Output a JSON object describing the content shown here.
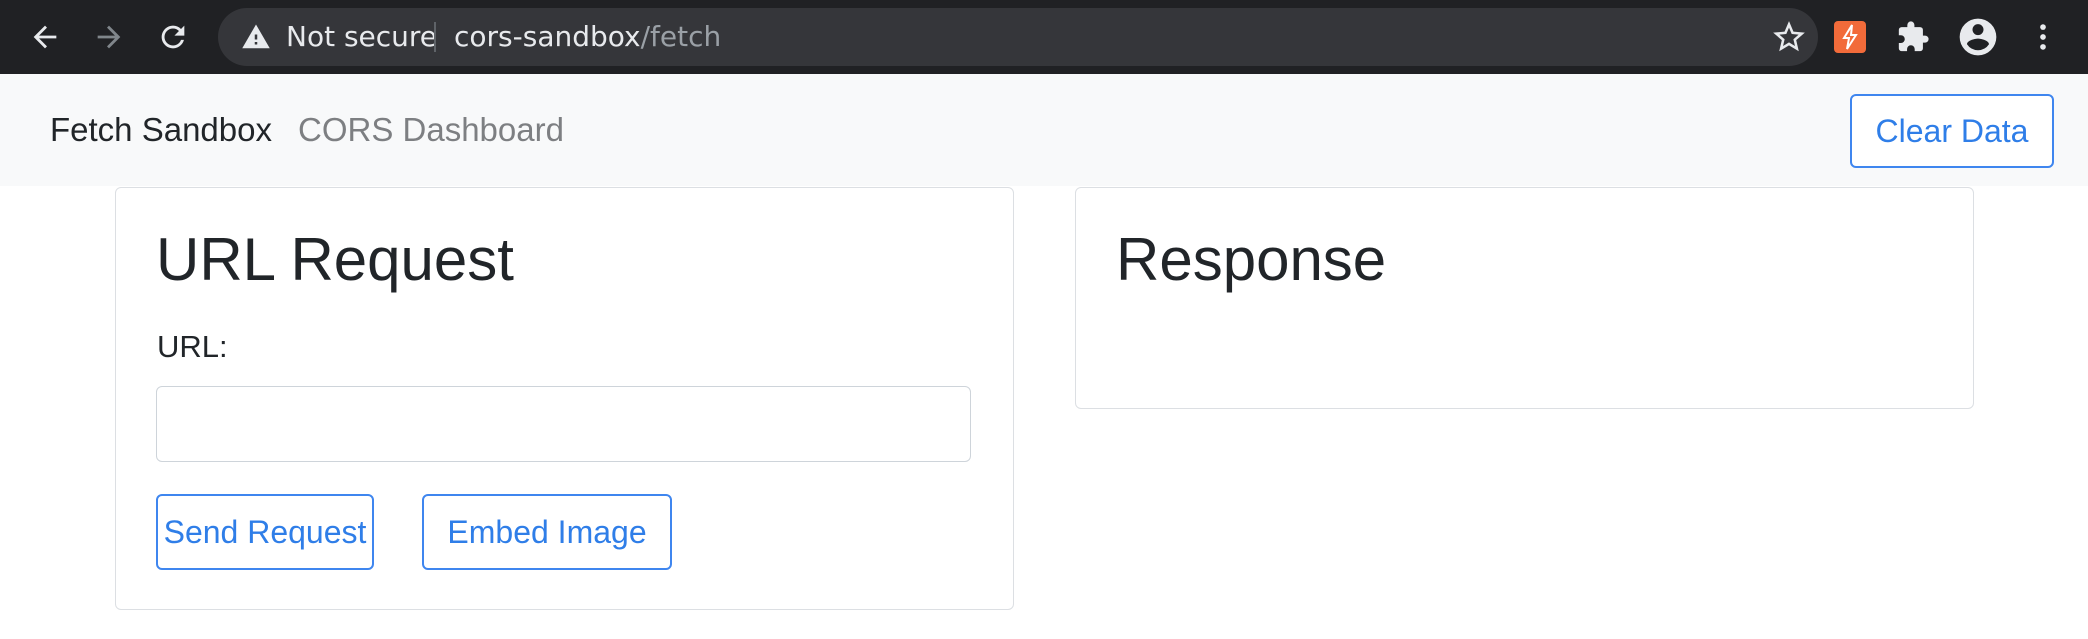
{
  "browser": {
    "security_label": "Not secure",
    "url_host": "cors-sandbox",
    "url_path": "/fetch",
    "icons": [
      "back-arrow-icon",
      "forward-arrow-icon",
      "reload-icon",
      "warning-icon",
      "star-icon",
      "extension-bolt-icon",
      "puzzle-icon",
      "profile-icon",
      "kebab-menu-icon"
    ],
    "colors": {
      "chrome_bg": "#202124",
      "omnibox_bg": "#35363a",
      "extension_accent": "#f26b3a"
    }
  },
  "navbar": {
    "brand": "Fetch Sandbox",
    "link": "CORS Dashboard",
    "clear_button": "Clear Data"
  },
  "request_card": {
    "title": "URL Request",
    "url_label": "URL:",
    "url_value": "",
    "url_placeholder": "",
    "send_button": "Send Request",
    "embed_button": "Embed Image"
  },
  "response_card": {
    "title": "Response"
  },
  "theme": {
    "primary": "#2f7ee8",
    "text": "#212529",
    "muted": "#7d7f82",
    "navbar_bg": "#f8f9fa",
    "card_border": "#dcdfe3"
  }
}
